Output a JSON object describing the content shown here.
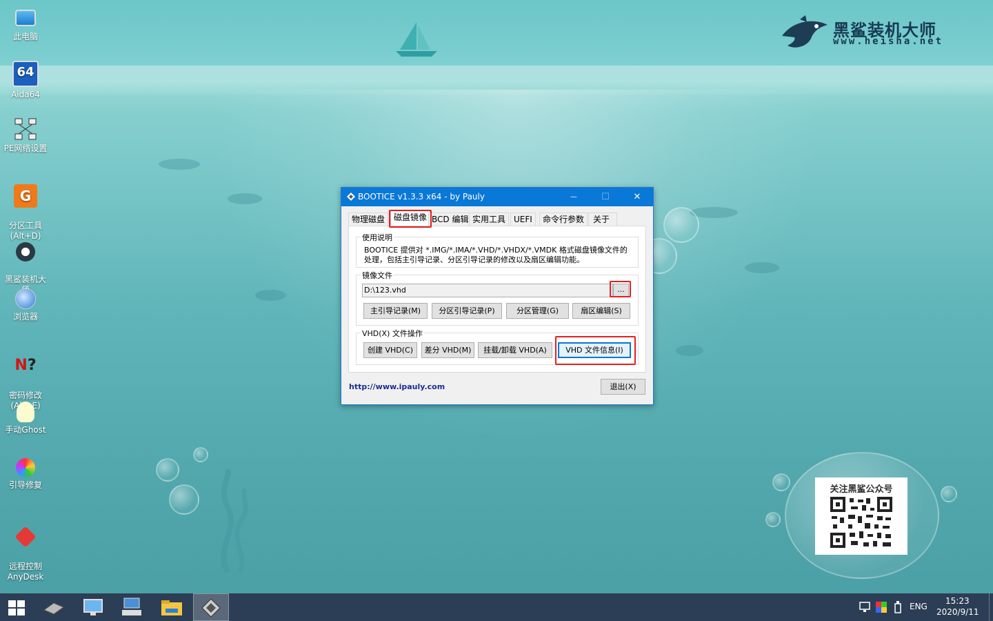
{
  "desktop": {
    "icons": [
      {
        "label": "此电脑",
        "icon": "computer-icon"
      },
      {
        "label": "Aida64",
        "icon": "aida64-icon"
      },
      {
        "label": "PE网络设置",
        "icon": "network-icon"
      },
      {
        "label": "分区工具\n(Alt+D)",
        "icon": "partition-tool-icon"
      },
      {
        "label": "黑鲨装机大\n师",
        "icon": "shark-icon"
      },
      {
        "label": "浏览器",
        "icon": "browser-icon"
      },
      {
        "label": "密码修改\n(Alt+E)",
        "icon": "password-icon"
      },
      {
        "label": "手动Ghost",
        "icon": "ghost-icon"
      },
      {
        "label": "引导修复",
        "icon": "boot-repair-icon"
      },
      {
        "label": "远程控制\nAnyDesk",
        "icon": "anydesk-icon"
      }
    ],
    "logo_title": "黑鲨装机大师",
    "logo_url": "www.heisha.net",
    "qr_title": "关注黑鲨公众号"
  },
  "window": {
    "title": "BOOTICE v1.3.3 x64 - by Pauly",
    "minimize": "—",
    "maximize": "☐",
    "close": "✕",
    "tabs": [
      "物理磁盘",
      "磁盘镜像",
      "BCD 编辑",
      "实用工具",
      "UEFI",
      "命令行参数",
      "关于"
    ],
    "active_tab": "磁盘镜像",
    "usage_label": "使用说明",
    "usage_text_1": "BOOTICE 提供对 *.IMG/*.IMA/*.VHD/*.VHDX/*.VMDK 格式磁盘镜像文件的",
    "usage_text_2": "处理，包括主引导记录、分区引导记录的修改以及扇区编辑功能。",
    "image_label": "镜像文件",
    "image_path": "D:\\123.vhd",
    "browse": "...",
    "buttons_image": [
      "主引导记录(M)",
      "分区引导记录(P)",
      "分区管理(G)",
      "扇区编辑(S)"
    ],
    "vhd_label": "VHD(X) 文件操作",
    "buttons_vhd": [
      "创建 VHD(C)",
      "差分 VHD(M)",
      "挂载/卸载 VHD(A)",
      "VHD 文件信息(I)"
    ],
    "link": "http://www.ipauly.com",
    "exit": "退出(X)"
  },
  "taskbar": {
    "lang": "ENG",
    "time": "15:23",
    "date": "2020/9/11"
  },
  "colors": {
    "titlebar": "#0a78d7",
    "highlight": "#e41e1e",
    "taskbar": "#2c3e55"
  }
}
